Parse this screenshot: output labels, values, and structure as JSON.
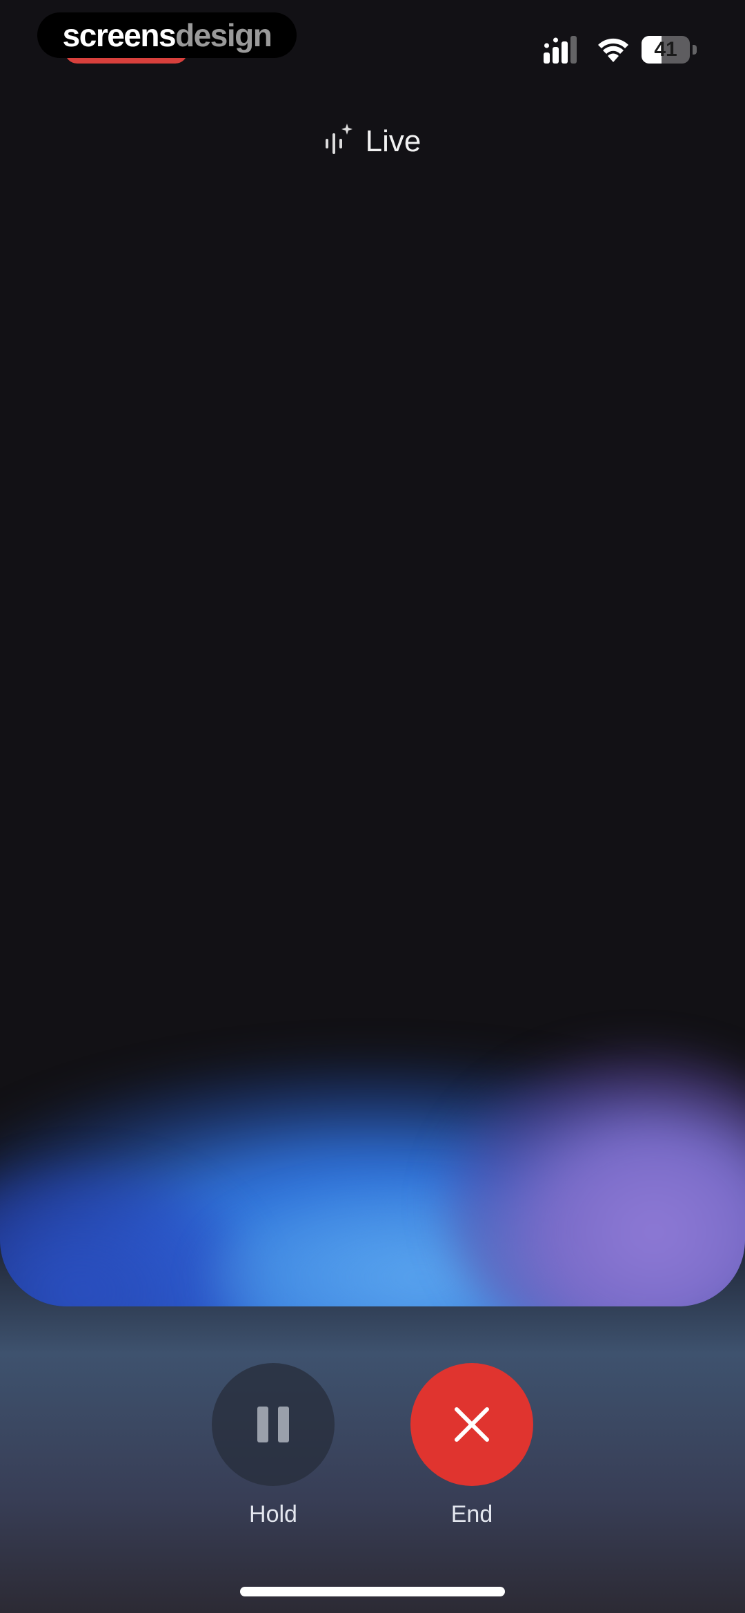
{
  "status_bar": {
    "battery_level": "41",
    "battery_fraction": 0.41
  },
  "watermark": {
    "part1": "screens",
    "part2": "design"
  },
  "header": {
    "title": "Live"
  },
  "controls": {
    "hold_label": "Hold",
    "end_label": "End"
  },
  "icons": {
    "live": "sparkle-waveform-icon",
    "hold": "pause-icon",
    "end": "close-icon",
    "signal": "signal-icon",
    "wifi": "wifi-icon"
  },
  "colors": {
    "background": "#121115",
    "end_button": "#e0342f",
    "hold_button": "#282e3c",
    "wave_blue": "#3c8ee8",
    "wave_purple": "#8f7ad6"
  }
}
